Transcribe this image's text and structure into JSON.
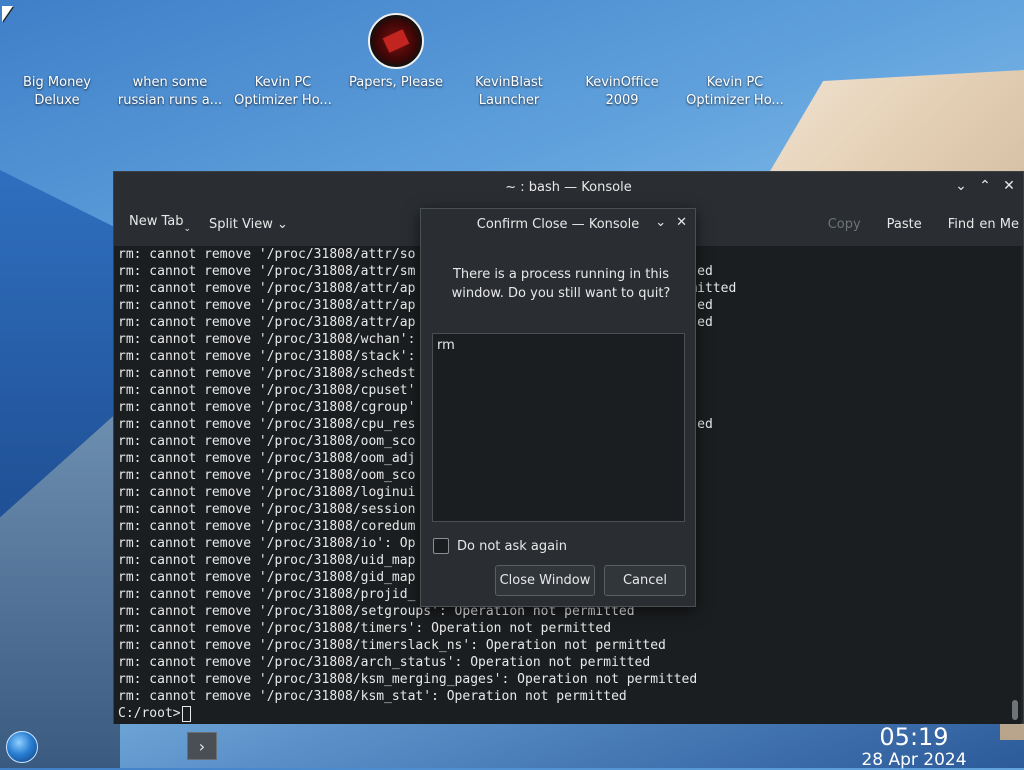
{
  "desktop": {
    "icons": [
      {
        "label": "Big Money\nDeluxe"
      },
      {
        "label": "when some\nrussian runs a..."
      },
      {
        "label": "Kevin PC\nOptimizer Ho..."
      },
      {
        "label": "Papers, Please"
      },
      {
        "label": "KevinBlast\nLauncher"
      },
      {
        "label": "KevinOffice\n2009"
      },
      {
        "label": "Kevin PC\nOptimizer Ho..."
      }
    ]
  },
  "konsole": {
    "title": "~ : bash — Konsole",
    "toolbar": {
      "new_tab": "New Tab",
      "split_view": "Split View",
      "copy": "Copy",
      "paste": "Paste",
      "find": "Find",
      "menu": "en Me"
    },
    "lines": [
      "rm: cannot remove '/proc/31808/attr/so",
      "rm: cannot remove '/proc/31808/attr/sm                                   ted",
      "rm: cannot remove '/proc/31808/attr/ap                                   mitted",
      "rm: cannot remove '/proc/31808/attr/ap                                   ted",
      "rm: cannot remove '/proc/31808/attr/ap                                   ted",
      "rm: cannot remove '/proc/31808/wchan':",
      "rm: cannot remove '/proc/31808/stack':",
      "rm: cannot remove '/proc/31808/schedst",
      "rm: cannot remove '/proc/31808/cpuset'",
      "rm: cannot remove '/proc/31808/cgroup'",
      "rm: cannot remove '/proc/31808/cpu_res                                   ted",
      "rm: cannot remove '/proc/31808/oom_sco",
      "rm: cannot remove '/proc/31808/oom_adj",
      "rm: cannot remove '/proc/31808/oom_sco",
      "rm: cannot remove '/proc/31808/loginui",
      "rm: cannot remove '/proc/31808/session",
      "rm: cannot remove '/proc/31808/coredum",
      "rm: cannot remove '/proc/31808/io': Op",
      "rm: cannot remove '/proc/31808/uid_map",
      "rm: cannot remove '/proc/31808/gid_map",
      "rm: cannot remove '/proc/31808/projid_",
      "rm: cannot remove '/proc/31808/setgroups': Operation not permitted",
      "rm: cannot remove '/proc/31808/timers': Operation not permitted",
      "rm: cannot remove '/proc/31808/timerslack_ns': Operation not permitted",
      "rm: cannot remove '/proc/31808/arch_status': Operation not permitted",
      "rm: cannot remove '/proc/31808/ksm_merging_pages': Operation not permitted",
      "rm: cannot remove '/proc/31808/ksm_stat': Operation not permitted"
    ],
    "prompt": "C:/root>"
  },
  "dialog": {
    "title": "Confirm Close — Konsole",
    "message": "There is a process running in this window. Do you still want to quit?",
    "processes": [
      "rm"
    ],
    "checkbox_label": "Do not ask again",
    "close_button": "Close Window",
    "cancel_button": "Cancel"
  },
  "clock": {
    "time": "05:19",
    "date": "28 Apr 2024"
  }
}
